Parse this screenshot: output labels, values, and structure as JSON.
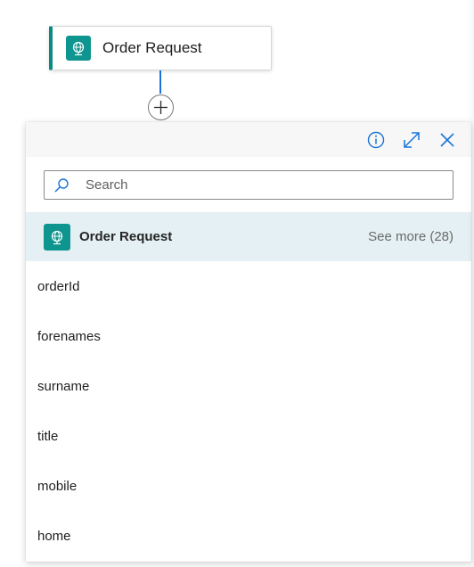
{
  "trigger": {
    "title": "Order Request",
    "icon": "globe-request-icon",
    "accent_color": "#0b8a83"
  },
  "connector": {
    "add_icon": "plus-icon",
    "line_color": "#1a73d9"
  },
  "panel": {
    "header": {
      "info_icon": "info-icon",
      "expand_icon": "expand-icon",
      "close_icon": "close-icon",
      "icon_color": "#1a73d9"
    },
    "search": {
      "placeholder": "Search",
      "value": ""
    },
    "group": {
      "title": "Order Request",
      "see_more": "See more (28)",
      "icon": "globe-request-icon",
      "background": "#e4f0f3"
    },
    "fields": [
      {
        "label": "orderId"
      },
      {
        "label": "forenames"
      },
      {
        "label": "surname"
      },
      {
        "label": "title"
      },
      {
        "label": "mobile"
      },
      {
        "label": "home"
      }
    ]
  }
}
